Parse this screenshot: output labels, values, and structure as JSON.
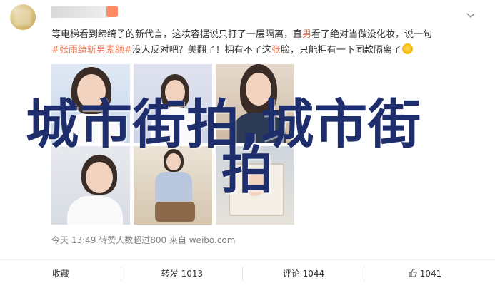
{
  "post": {
    "line1": "等电梯看到缔绮子的新代言，这妆容据说只打了一层隔离，直",
    "line1_hl": "男",
    "line1_end": "看了绝对当做没化妆，说一句",
    "line2_hashtag": "#张雨绮斩男素颜#",
    "line2_a": "没人反对吧？美翻了！拥有不了这",
    "line2_hl": "张",
    "line2_b": "脸，只能拥有一下同款隔离了",
    "meta": "今天 13:49 转赞人数超过800    来自 weibo.com"
  },
  "watermark": {
    "line1": "城市街拍,城市街",
    "line2": "拍"
  },
  "actions": {
    "favorite": "收藏",
    "repost": "转发 1013",
    "comment": "评论 1044",
    "like": "1041"
  },
  "colors": {
    "highlight": "#eb7350",
    "watermark": "#1e2d6b"
  },
  "icons": {
    "menu": "chevron-down-icon",
    "like": "thumbs-up-icon",
    "emoji": "smile-emoji-icon"
  }
}
